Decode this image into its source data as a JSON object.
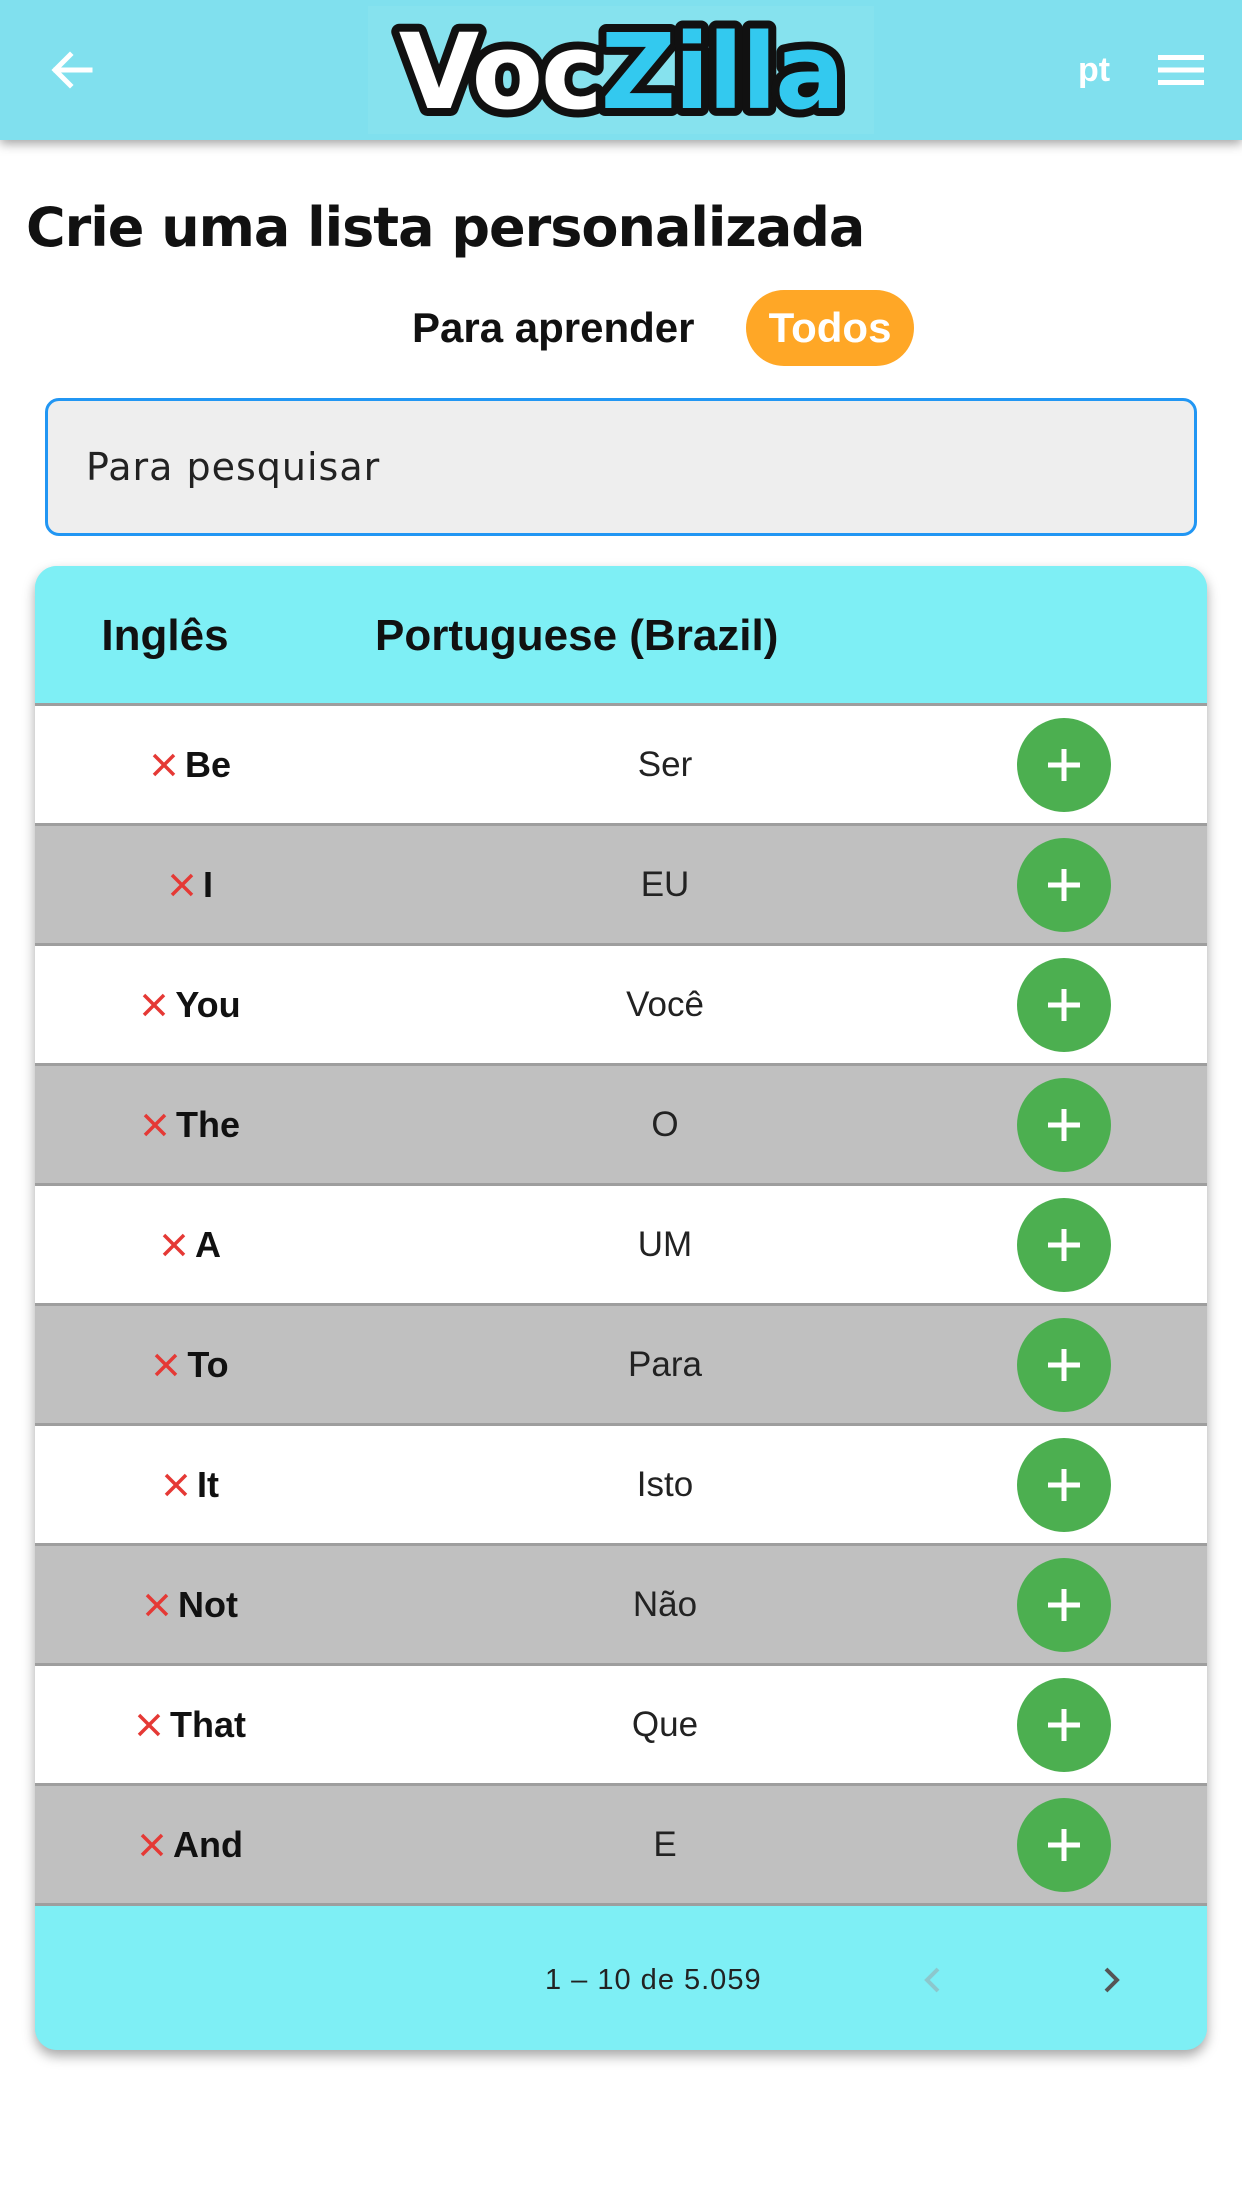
{
  "header": {
    "logo_part1": "Voc",
    "logo_part2": "Zilla",
    "language_code": "pt",
    "back_icon": "arrow-left-icon",
    "menu_icon": "hamburger-menu-icon"
  },
  "page": {
    "title": "Crie uma lista personalizada"
  },
  "filter": {
    "learn_label": "Para aprender",
    "all_label": "Todos",
    "active": "Todos",
    "active_color": "#ffa726"
  },
  "search": {
    "placeholder": "Para pesquisar",
    "value": ""
  },
  "table": {
    "columns": [
      "Inglês",
      "Portuguese (Brazil)"
    ],
    "rows": [
      {
        "en": "Be",
        "pt": "Ser"
      },
      {
        "en": "I",
        "pt": "EU"
      },
      {
        "en": "You",
        "pt": "Você"
      },
      {
        "en": "The",
        "pt": "O"
      },
      {
        "en": "A",
        "pt": "UM"
      },
      {
        "en": "To",
        "pt": "Para"
      },
      {
        "en": "It",
        "pt": "Isto"
      },
      {
        "en": "Not",
        "pt": "Não"
      },
      {
        "en": "That",
        "pt": "Que"
      },
      {
        "en": "And",
        "pt": "E"
      }
    ],
    "remove_icon": "x-icon",
    "add_icon": "plus-icon"
  },
  "pagination": {
    "info": "1 – 10 de 5.059",
    "prev_icon": "chevron-left-icon",
    "next_icon": "chevron-right-icon"
  },
  "colors": {
    "header_bg": "#80e0ee",
    "table_header_bg": "#7eeff5",
    "add_button": "#4caf50",
    "remove_mark": "#e53935",
    "logo_accent": "#33c9ef"
  }
}
